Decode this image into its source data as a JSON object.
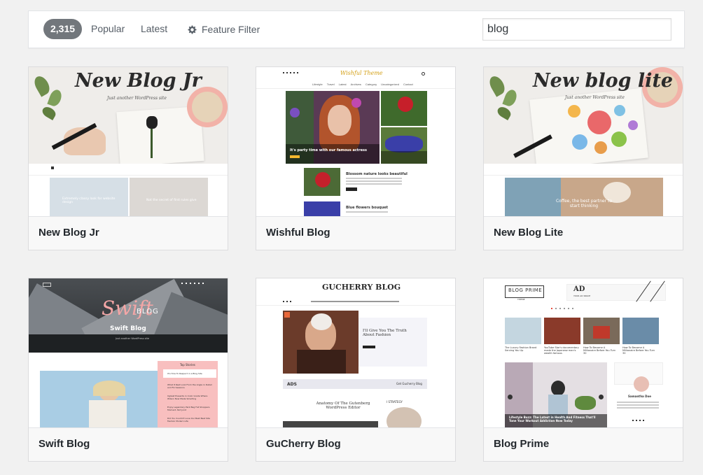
{
  "filter": {
    "count": "2,315",
    "popular": "Popular",
    "latest": "Latest",
    "feature_filter": "Feature Filter",
    "search_value": "blog"
  },
  "themes": [
    {
      "name": "New Blog Jr",
      "shot_title": "New Blog Jr",
      "shot_sub": "Just another WordPress site",
      "card_texts": [
        "Extremely classy look for website design",
        "Not the secret of first rules give"
      ]
    },
    {
      "name": "Wishful Blog",
      "shot_logo": "Wishful Theme",
      "menu": [
        "Lifestyle",
        "Travel",
        "Latest",
        "Archives",
        "Category",
        "Uncategorized",
        "Contact"
      ],
      "hero_caption": "It's party time with our famous actress",
      "side_caption": "Blossom nature looks beautiful",
      "post1": "Blossom nature looks beautiful",
      "post2": "Blue flowers bouquet"
    },
    {
      "name": "New Blog Lite",
      "shot_title": "New blog lite",
      "shot_sub": "Just another WordPress site",
      "banner_text": "Coffee, the best partner to start thinking"
    },
    {
      "name": "Swift Blog",
      "shot_logo": "Swift",
      "shot_logo2": "BLOG",
      "shot_title": "Swift Blog",
      "shot_sub": "Just another WordPress site",
      "widget_title": "Top Stories",
      "widget_items": [
        "It's How To Respect in a Blog Site",
        "What It Rest Look From the Angle in Detail and Fix Sessions",
        "Ugliest Presents in Color Grade Where Wilson Now Made Smarting",
        "Enjoy Legendary Park Bag Full Shoppers Moment, Not Joint",
        "Did You Couldn't Love Our Best Best Site Fashion Modern Life"
      ]
    },
    {
      "name": "GuCherry Blog",
      "shot_title": "GUCHERRY BLOG",
      "feature_title": "I'll Give You The Truth About Fashion",
      "ad_label": "ADS",
      "ad_button": "Get Gucherry Blog",
      "post_title": "Anatomy Of The Gutenberg WordPress Editor",
      "side_label": "I STRATEGY"
    },
    {
      "name": "Blog Prime",
      "shot_logo": "BLOG PRIME",
      "shot_logo_sub": "THEME",
      "ad_text": "AD",
      "ad_sub": "YOUR AD SPACE",
      "captions": [
        "The Luxury Fashion Brand Serving You Up",
        "YouTube Star's documentary made the Japanese man's wealth famous",
        "How To Become A Millionaire Before You Turn 30",
        "How To Become A Millionaire Before You Turn 30"
      ],
      "slider_caption": "Lifestyle Buzz: The Latest in Health And Fitness That'll Tone Your Workout Addiction Now Today",
      "author": "Samantha Doe"
    }
  ],
  "colors": {
    "count_bg": "#72777c",
    "name_bar_bg": "#f8f8f8",
    "page_bg": "#f1f1f1",
    "wishful_yellow": "#f5b82e",
    "swift_pink": "#f8bfbf",
    "prime_red": "#e94b3c"
  }
}
